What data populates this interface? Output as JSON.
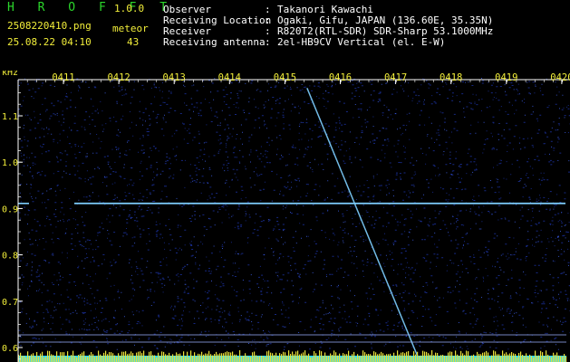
{
  "header": {
    "app_name": "H R O F F T",
    "version": "1.0.0",
    "filename": "2508220410.png",
    "datetime": "25.08.22 04:10",
    "meteor_label": "meteor",
    "meteor_count": "43",
    "fields": [
      {
        "label": "Observer",
        "value": "Takanori Kawachi"
      },
      {
        "label": "Receiving Location",
        "value": "Ogaki, Gifu, JAPAN (136.60E, 35.35N)"
      },
      {
        "label": "Receiver",
        "value": "R820T2(RTL-SDR) SDR-Sharp 53.1000MHz"
      },
      {
        "label": "Receiving antenna",
        "value": "2el-HB9CV Vertical (el. E-W)"
      }
    ]
  },
  "colors": {
    "background": "#000000",
    "noise": "#1a2f9a",
    "signal": "#7fd0ff",
    "header_green": "#2bd62b",
    "header_yellow": "#f2ee3a",
    "baseline_yellow": "#e8e03a",
    "baseline_cyan": "#25d8ff"
  },
  "chart_data": {
    "type": "heatmap",
    "ylabel": "kHz",
    "time_ticks": [
      "0411",
      "0412",
      "0413",
      "0414",
      "0415",
      "0416",
      "0417",
      "0418",
      "0419",
      "0420"
    ],
    "freq_ticks": [
      "1.1",
      "1.0",
      "0.9",
      "0.8",
      "0.7",
      "0.6"
    ],
    "ylim": [
      0.575,
      1.16
    ],
    "carrier_khz": 0.91,
    "echo_track": {
      "start_time": "0415.4",
      "start_khz": 1.16,
      "end_time": "0417.4",
      "end_khz": 0.58
    }
  }
}
